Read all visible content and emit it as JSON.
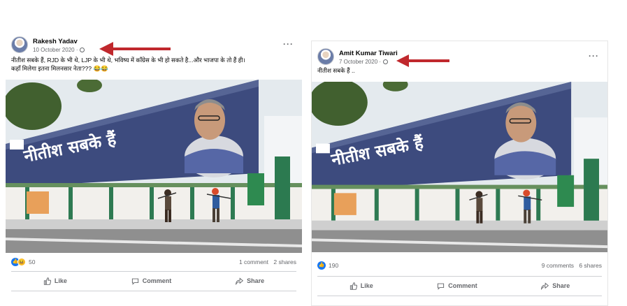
{
  "posts": [
    {
      "author": "Rakesh Yadav",
      "date": "10 October 2020 ·",
      "caption_line1": "नीतीश सबके हैं, RJD के भी थे, LJP के भी थे, भविष्य में कॉंग्रेस के भी हो सकते है...और भाजपा के तो हैं ही।",
      "caption_line2": "कहाँ मिलेगा इतना मिलनसार नेता??? 😂😂",
      "banner_text": "नीतीश सबके हैं",
      "reaction_count": "50",
      "comments": "1 comment",
      "shares": "2 shares",
      "reactions": [
        "like",
        "haha"
      ]
    },
    {
      "author": "Amit Kumar Tiwari",
      "date": "7 October 2020 ·",
      "caption_line1": "नीतीश सबके हैं ..",
      "banner_text": "नीतीश सबके हैं",
      "reaction_count": "190",
      "comments": "9 comments",
      "shares": "6 shares",
      "reactions": [
        "like"
      ]
    }
  ],
  "actions": {
    "like": "Like",
    "comment": "Comment",
    "share": "Share"
  },
  "icons": {
    "menu": "more-horizontal-icon",
    "visibility": "globe-icon",
    "annotation": "red-arrow"
  },
  "colors": {
    "arrow": "#c0282d",
    "like_blue": "#1877f2",
    "banner": "#3b4a7c"
  }
}
